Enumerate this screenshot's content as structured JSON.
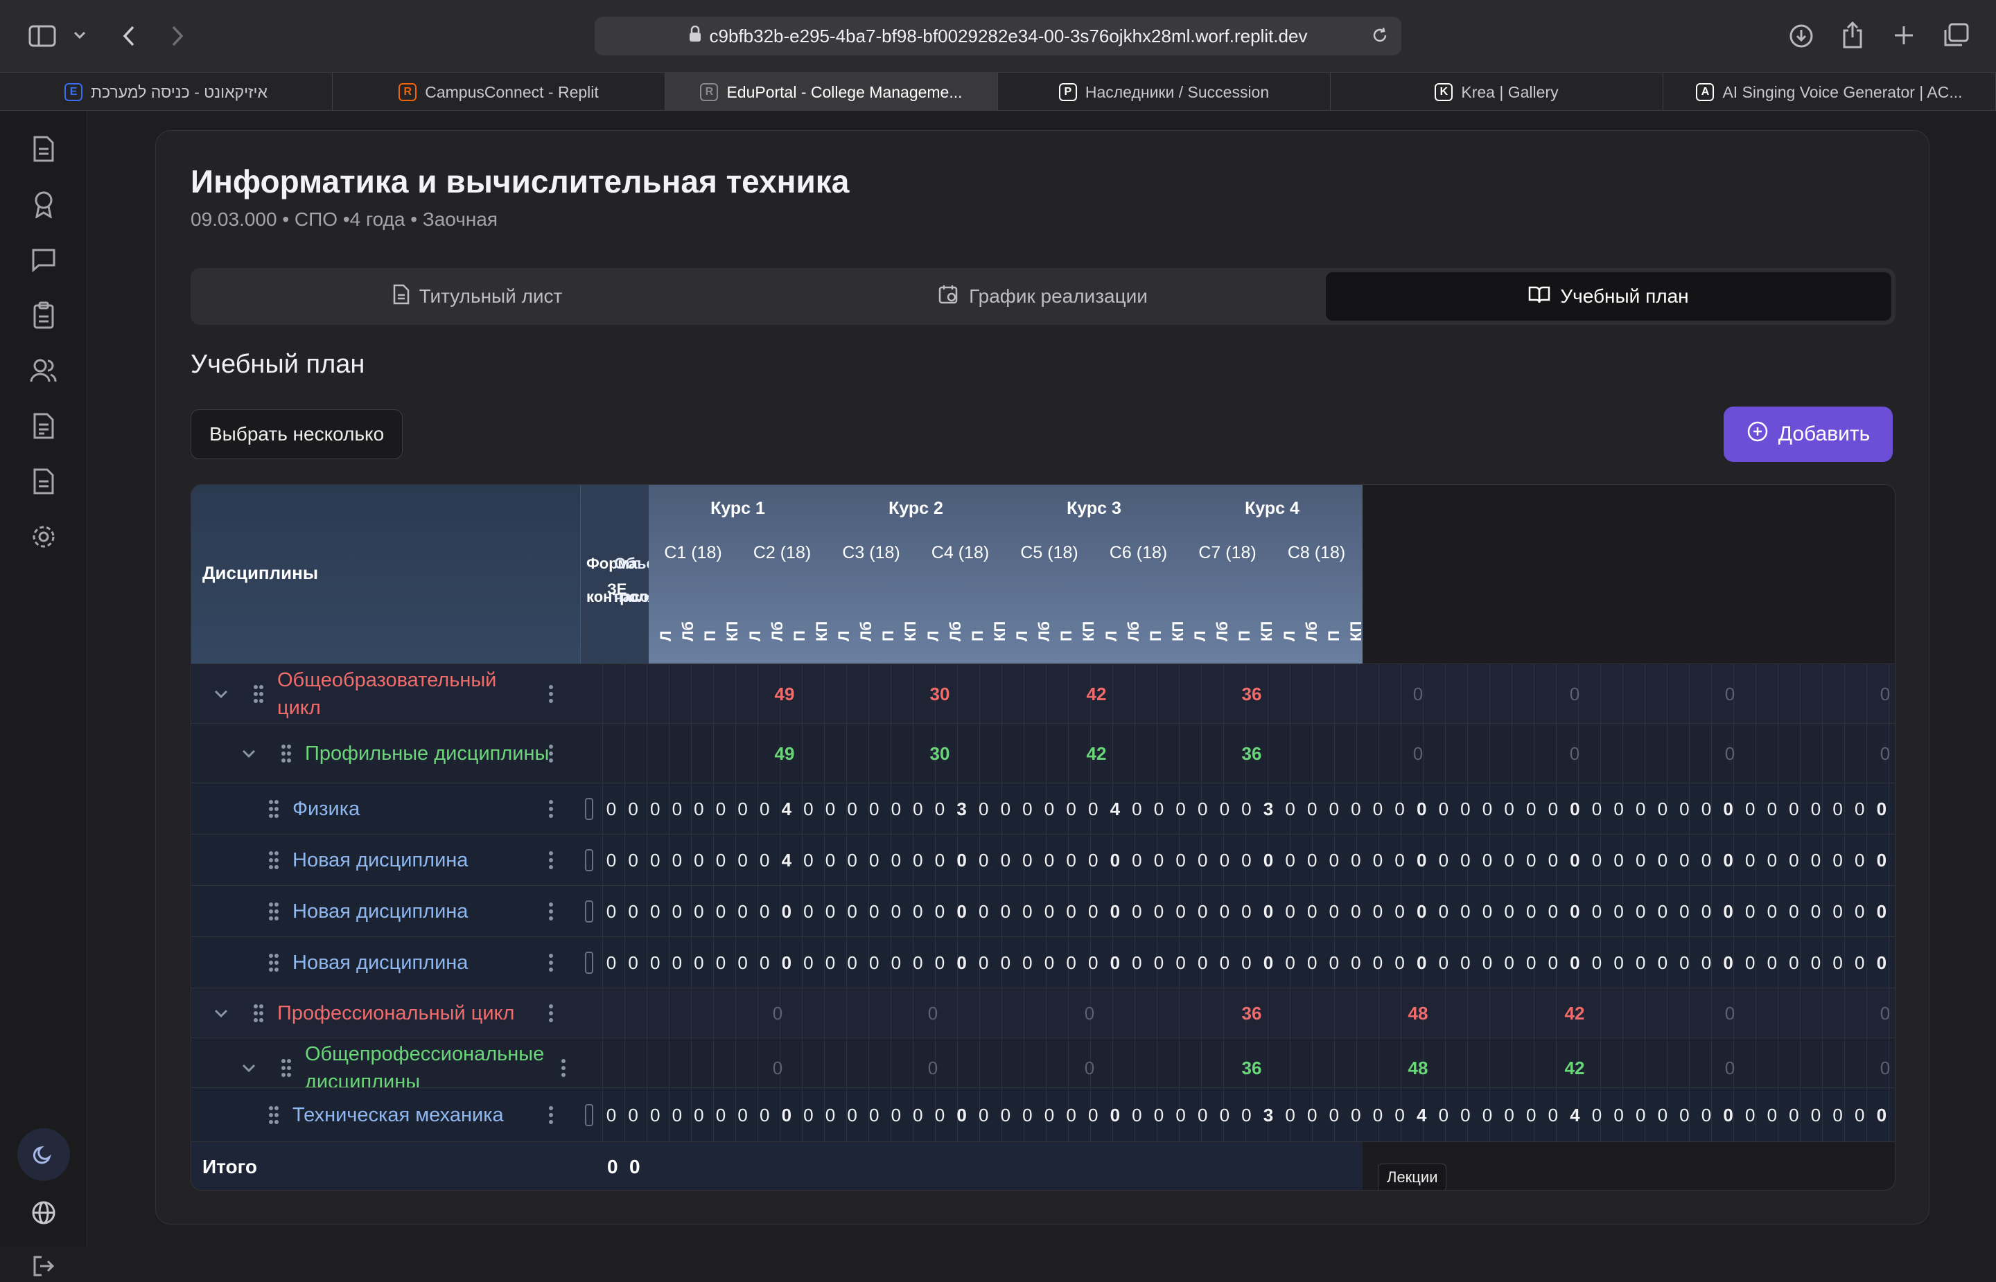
{
  "browser": {
    "url": "c9bfb32b-e295-4ba7-bf98-bf0029282e34-00-3s76ojkhx28ml.worf.replit.dev",
    "tabs": [
      {
        "label": "איזיקאונט - כניסה למערכת",
        "favicon": "E",
        "color": "#3a6df0"
      },
      {
        "label": "CampusConnect - Replit",
        "favicon": "R",
        "color": "#f26207"
      },
      {
        "label": "EduPortal - College Manageme...",
        "favicon": "R",
        "color": "#8a8a90"
      },
      {
        "label": "Наследники / Succession",
        "favicon": "P",
        "color": "#ffffff"
      },
      {
        "label": "Krea | Gallery",
        "favicon": "K",
        "color": "#ffffff"
      },
      {
        "label": "AI Singing Voice Generator | AC...",
        "favicon": "A",
        "color": "#ffffff"
      }
    ],
    "active_tab": 2
  },
  "header": {
    "title": "Информатика и вычислительная техника",
    "subtitle": "09.03.000 • СПО •4 года • Заочная"
  },
  "page_tabs": [
    {
      "label": "Титульный лист"
    },
    {
      "label": "График реализации"
    },
    {
      "label": "Учебный план"
    }
  ],
  "section": {
    "title": "Учебный план",
    "select_many": "Выбрать несколько",
    "add": "Добавить"
  },
  "table": {
    "disciplines_header": "Дисциплины",
    "form_header": "Форма контроля",
    "hours_header": "Объем часов",
    "credits_header": "ЗЕ",
    "courses": [
      "Курс 1",
      "Курс 2",
      "Курс 3",
      "Курс 4"
    ],
    "semesters": [
      "С1 (18)",
      "С2 (18)",
      "С3 (18)",
      "С4 (18)",
      "С5 (18)",
      "С6 (18)",
      "С7 (18)",
      "С8 (18)"
    ],
    "subcols": [
      "Л",
      "Лб",
      "П",
      "КП"
    ],
    "tooltip": "Лекции",
    "total_label": "Итого",
    "total_values": [
      "0",
      "0"
    ],
    "rows": [
      {
        "type": "cyc",
        "name": "Общеобразовательный цикл",
        "sums": [
          "49",
          "30",
          "42",
          "36"
        ],
        "muted": [
          "0",
          "0",
          "0",
          "0"
        ]
      },
      {
        "type": "grp",
        "name": "Профильные дисциплины",
        "sums": [
          "49",
          "30",
          "42",
          "36"
        ],
        "muted": [
          "0",
          "0",
          "0",
          "0"
        ]
      },
      {
        "type": "item",
        "name": "Физика",
        "lead": [
          "4",
          "3",
          "4",
          "3"
        ],
        "trail": [
          "0",
          "0",
          "0",
          "0"
        ]
      },
      {
        "type": "item",
        "name": "Новая дисциплина",
        "lead": [
          "4",
          "0",
          "0",
          "0"
        ],
        "trail": [
          "0",
          "0",
          "0",
          "0"
        ]
      },
      {
        "type": "item",
        "name": "Новая дисциплина",
        "lead": [
          "0",
          "0",
          "0",
          "0"
        ],
        "trail": [
          "0",
          "0",
          "0",
          "0"
        ]
      },
      {
        "type": "item",
        "name": "Новая дисциплина",
        "lead": [
          "0",
          "0",
          "0",
          "0"
        ],
        "trail": [
          "0",
          "0",
          "0",
          "0"
        ]
      },
      {
        "type": "cyc",
        "name": "Профессиональный цикл",
        "sums": [
          "0",
          "0",
          "0",
          "36"
        ],
        "muted2": [
          "48",
          "42",
          "0",
          "0"
        ]
      },
      {
        "type": "grp",
        "name": "Общепрофессиональные дисциплины",
        "sums": [
          "0",
          "0",
          "0",
          "36"
        ],
        "muted2": [
          "48",
          "42",
          "0",
          "0"
        ]
      },
      {
        "type": "item",
        "name": "Техническая механика",
        "lead": [
          "0",
          "0",
          "0",
          "3"
        ],
        "trail": [
          "4",
          "4",
          "0",
          "0"
        ]
      }
    ]
  },
  "colors": {
    "accent": "#6c4fd6",
    "cycle": "#f06b6b",
    "group": "#6bd679",
    "item": "#8fb7f0"
  }
}
